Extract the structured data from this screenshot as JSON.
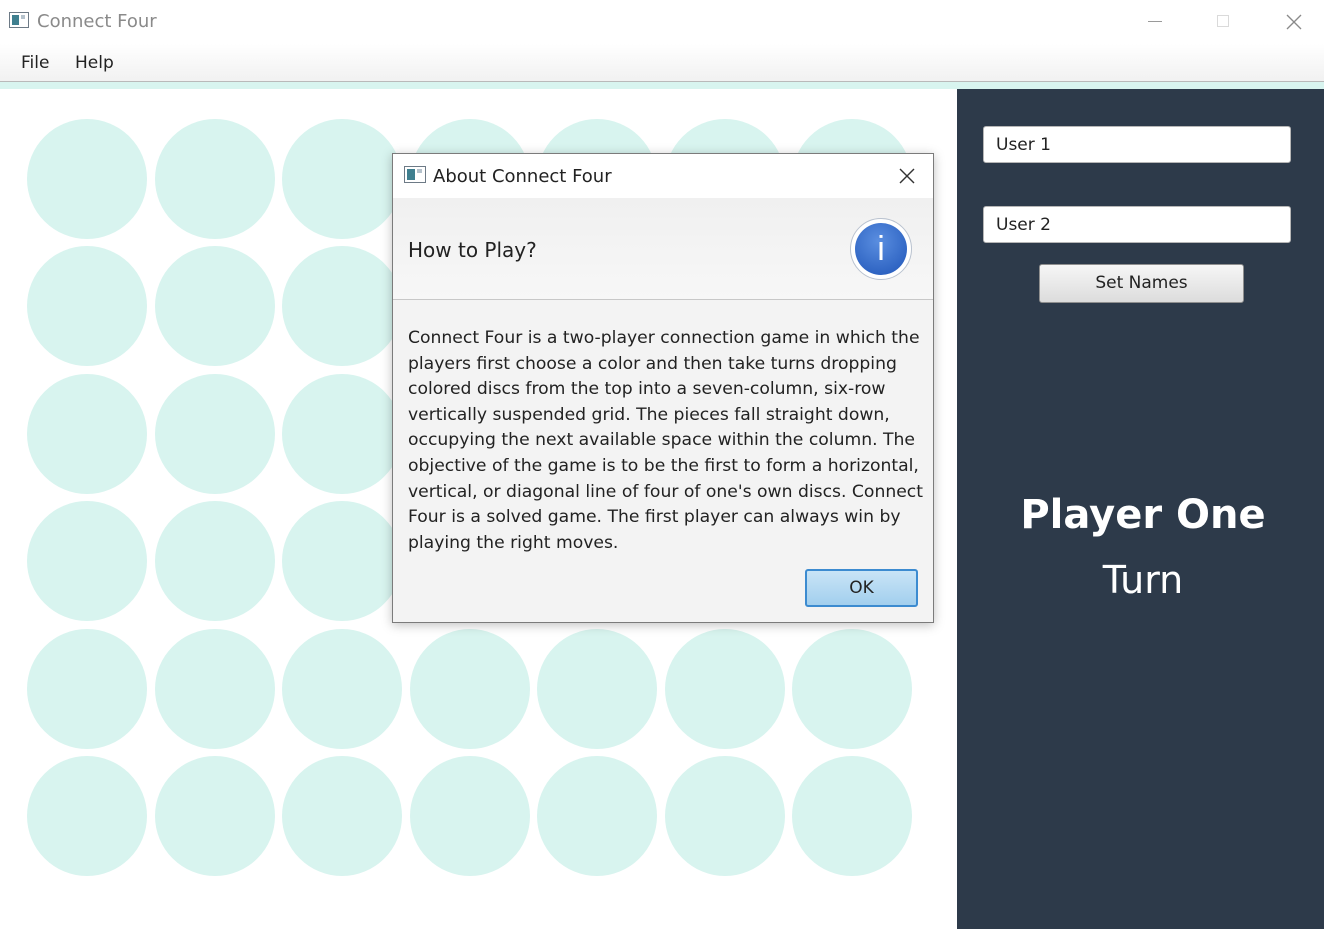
{
  "window": {
    "title": "Connect Four",
    "app_icon": "app-window-icon",
    "controls": [
      "minimize-icon",
      "maximize-icon",
      "close-icon"
    ]
  },
  "menu": {
    "file": "File",
    "help": "Help"
  },
  "board": {
    "columns": 7,
    "rows": 6,
    "empty_disc_color": "#d8f4ef"
  },
  "sidebar": {
    "background": "#2d3a4a",
    "player1_value": "User 1",
    "player2_value": "User 2",
    "set_names_label": "Set Names",
    "current_player": "Player One",
    "turn_label": "Turn"
  },
  "dialog": {
    "title": "About Connect Four",
    "heading": "How to Play?",
    "icon": "info-icon",
    "body": "Connect Four is a two-player connection game in which the players first choose a color and then take turns dropping colored discs from the top into a seven-column, six-row vertically suspended grid. The pieces fall straight down, occupying the next available space within the column. The objective of the game is to be the first to form a horizontal, vertical, or diagonal line of four of one's own discs. Connect Four is a solved game. The first player can always win by playing the right moves.",
    "ok_label": "OK",
    "info_glyph": "i"
  }
}
